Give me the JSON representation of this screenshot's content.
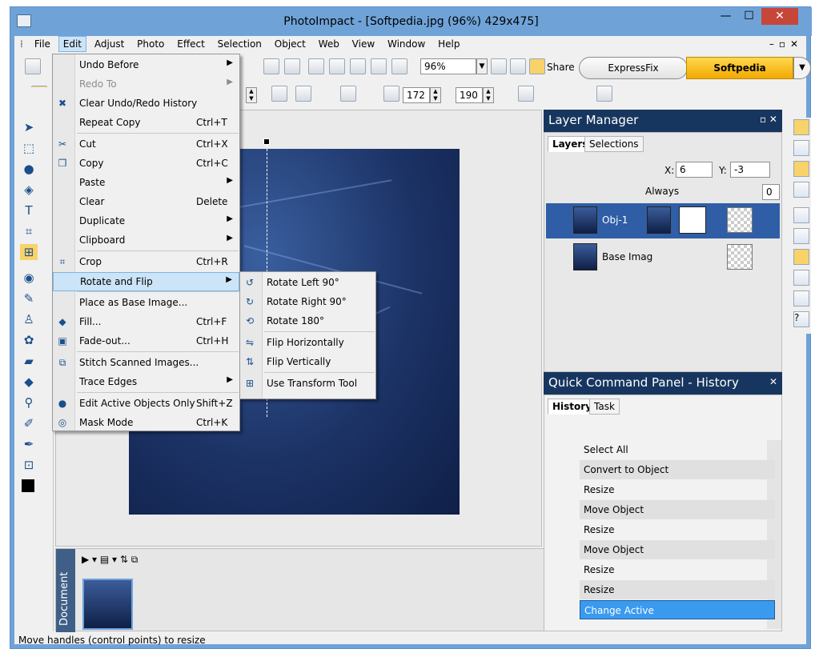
{
  "window": {
    "title": "PhotoImpact - [Softpedia.jpg (96%) 429x475]"
  },
  "menubar": [
    "File",
    "Edit",
    "Adjust",
    "Photo",
    "Effect",
    "Selection",
    "Object",
    "Web",
    "View",
    "Window",
    "Help"
  ],
  "toolbar": {
    "zoom": "96%",
    "share": "Share",
    "expressfix": "ExpressFix",
    "softpedia": "Softpedia",
    "w": "172",
    "h": "190"
  },
  "edit_menu": [
    {
      "label": "Undo Before",
      "shortcut": "",
      "arrow": true,
      "disabled": false
    },
    {
      "label": "Redo To",
      "shortcut": "",
      "arrow": true,
      "disabled": true
    },
    {
      "label": "Clear Undo/Redo History",
      "shortcut": "",
      "arrow": false,
      "disabled": false
    },
    {
      "label": "Repeat Copy",
      "shortcut": "Ctrl+T",
      "arrow": false,
      "disabled": false
    },
    {
      "label": "Cut",
      "shortcut": "Ctrl+X",
      "arrow": false,
      "disabled": false
    },
    {
      "label": "Copy",
      "shortcut": "Ctrl+C",
      "arrow": false,
      "disabled": false
    },
    {
      "label": "Paste",
      "shortcut": "",
      "arrow": true,
      "disabled": false
    },
    {
      "label": "Clear",
      "shortcut": "Delete",
      "arrow": false,
      "disabled": false
    },
    {
      "label": "Duplicate",
      "shortcut": "",
      "arrow": true,
      "disabled": false
    },
    {
      "label": "Clipboard",
      "shortcut": "",
      "arrow": true,
      "disabled": false
    },
    {
      "label": "Crop",
      "shortcut": "Ctrl+R",
      "arrow": false,
      "disabled": false
    },
    {
      "label": "Rotate and Flip",
      "shortcut": "",
      "arrow": true,
      "disabled": false
    },
    {
      "label": "Place as Base Image...",
      "shortcut": "",
      "arrow": false,
      "disabled": false
    },
    {
      "label": "Fill...",
      "shortcut": "Ctrl+F",
      "arrow": false,
      "disabled": false
    },
    {
      "label": "Fade-out...",
      "shortcut": "Ctrl+H",
      "arrow": false,
      "disabled": false
    },
    {
      "label": "Stitch Scanned Images...",
      "shortcut": "",
      "arrow": false,
      "disabled": false
    },
    {
      "label": "Trace Edges",
      "shortcut": "",
      "arrow": true,
      "disabled": false
    },
    {
      "label": "Edit Active Objects Only",
      "shortcut": "Shift+Z",
      "arrow": false,
      "disabled": false
    },
    {
      "label": "Mask Mode",
      "shortcut": "Ctrl+K",
      "arrow": false,
      "disabled": false
    }
  ],
  "rotate_submenu": [
    "Rotate Left 90°",
    "Rotate Right 90°",
    "Rotate 180°",
    "Flip Horizontally",
    "Flip Vertically",
    "Use Transform Tool"
  ],
  "layer_manager": {
    "title": "Layer Manager",
    "tabs": [
      "Layers",
      "Selections"
    ],
    "x_label": "X:",
    "x": "6",
    "y_label": "Y:",
    "y": "-3",
    "merge_mode": "Always",
    "opacity": "0",
    "layers": [
      "Obj-1",
      "Base Imag"
    ]
  },
  "history_panel": {
    "title": "Quick Command Panel - History",
    "tabs": [
      "History",
      "Task"
    ],
    "items": [
      "Select All",
      "Convert to Object",
      "Resize",
      "Move Object",
      "Resize",
      "Move Object",
      "Resize",
      "Resize",
      "Change Active"
    ]
  },
  "document_tab": "Document",
  "status": "Move handles (control points) to resize"
}
